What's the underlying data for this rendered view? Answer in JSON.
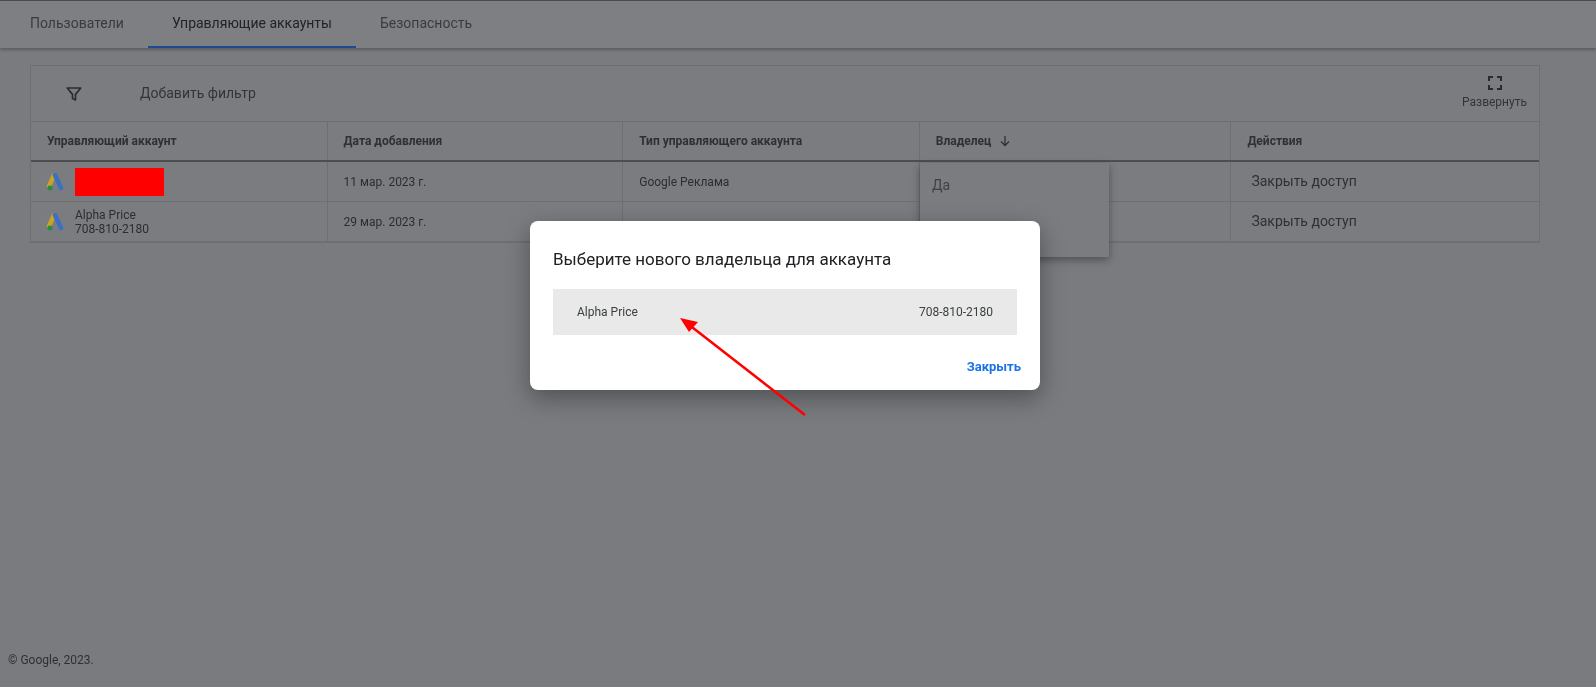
{
  "tabs": [
    {
      "label": "Пользователи",
      "selected": false
    },
    {
      "label": "Управляющие аккаунты",
      "selected": true
    },
    {
      "label": "Безопасность",
      "selected": false
    }
  ],
  "toolbar": {
    "filter_label": "Добавить фильтр",
    "expand_label": "Развернуть"
  },
  "table": {
    "columns": [
      {
        "label": "Управляющий аккаунт",
        "sorted": false
      },
      {
        "label": "Дата добавления",
        "sorted": false
      },
      {
        "label": "Тип управляющего аккаунта",
        "sorted": false
      },
      {
        "label": "Владелец",
        "sorted": true
      },
      {
        "label": "Действия",
        "sorted": false
      }
    ],
    "rows": [
      {
        "redacted": true,
        "date": "11 мар. 2023 г.",
        "type": "Google Реклама",
        "action": "Закрыть доступ"
      },
      {
        "redacted": false,
        "name": "Alpha Price",
        "id": "708-810-2180",
        "date": "29 мар. 2023 г.",
        "action": "Закрыть доступ"
      }
    ]
  },
  "owner_menu": {
    "options": [
      "Да"
    ]
  },
  "dialog": {
    "title": "Выберите нового владельца для аккаунта",
    "options": [
      {
        "name": "Alpha Price",
        "id": "708-810-2180",
        "highlighted": true
      }
    ],
    "close_label": "Закрыть"
  },
  "annotation": {
    "arrow": true
  },
  "footer": "© Google, 2023."
}
